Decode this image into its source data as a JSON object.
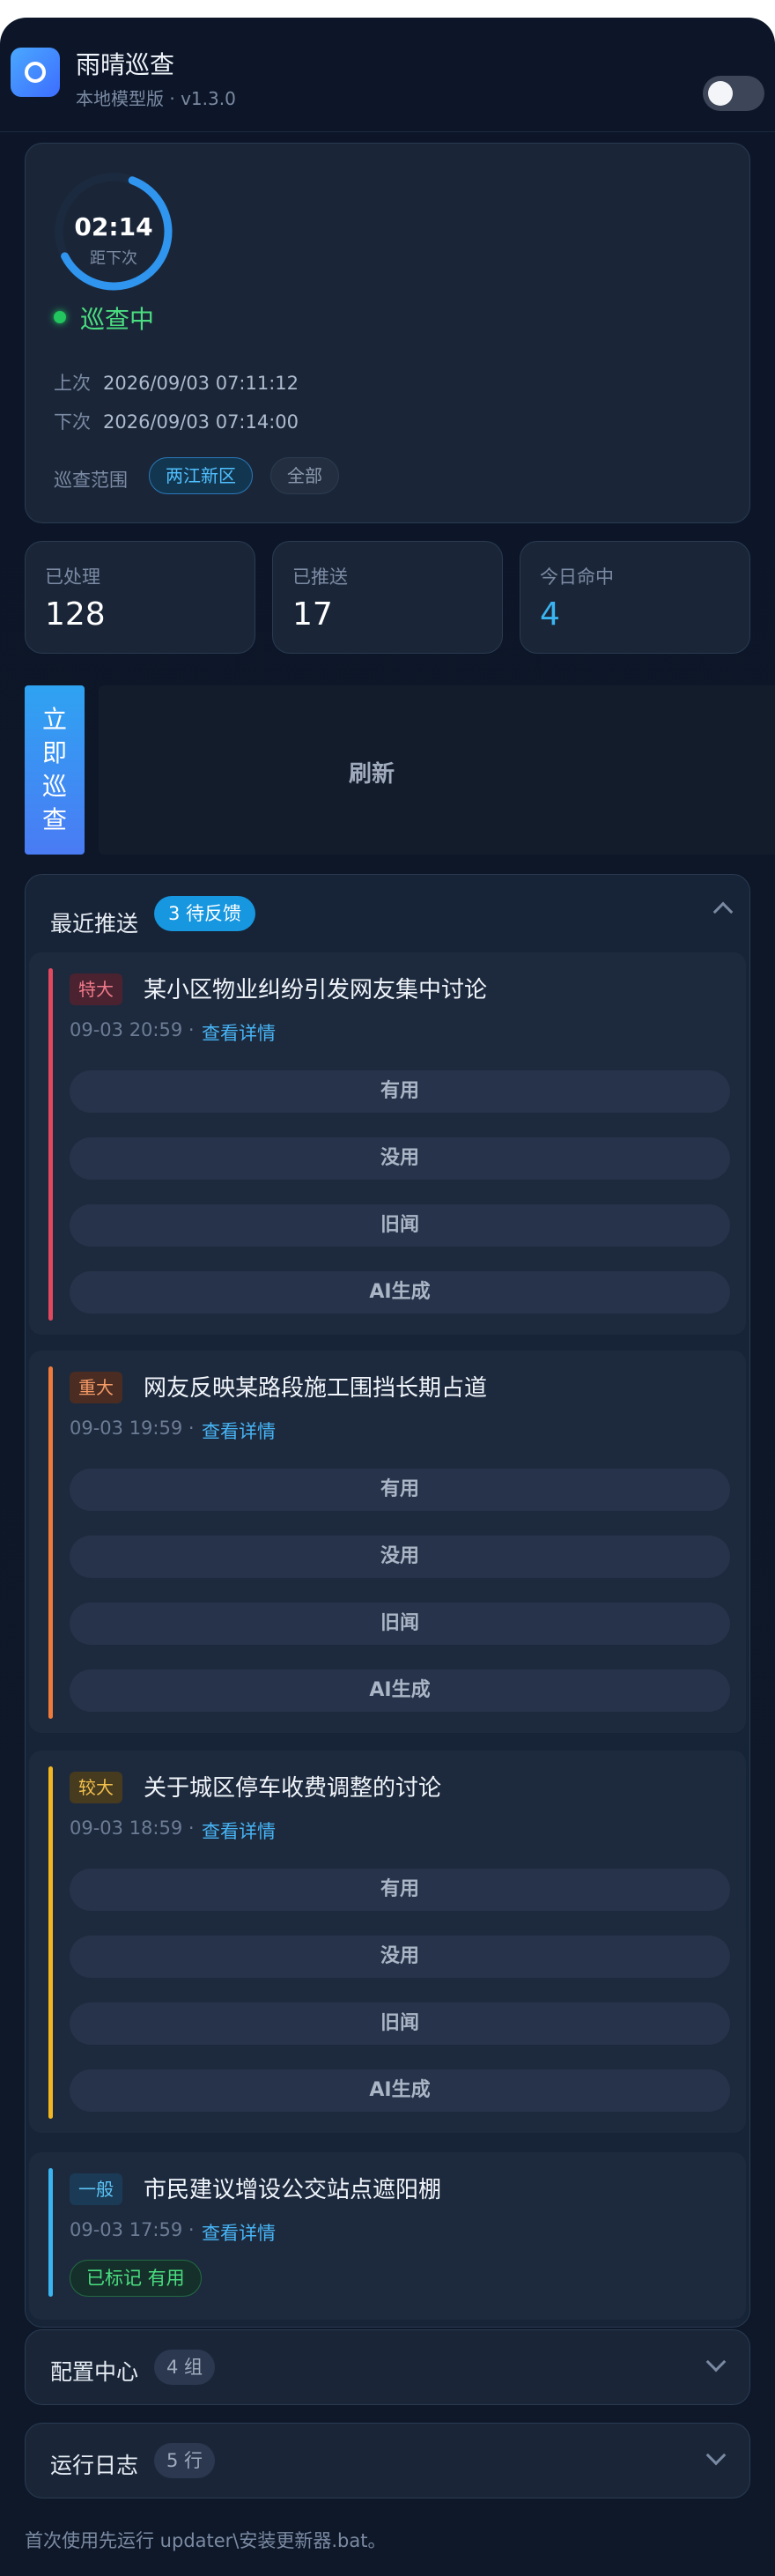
{
  "app": {
    "title": "雨晴巡查",
    "subtitle": "本地模型版 · v1.3.0",
    "toggle_on": false
  },
  "status": {
    "countdown": "02:14",
    "countdown_label": "距下次",
    "progress": 0.62,
    "state": "巡查中",
    "last_label": "上次",
    "last_time": "2026/09/03 07:11:12",
    "next_label": "下次",
    "next_time": "2026/09/03 07:14:00",
    "scope_label": "巡查范围",
    "scope_options": [
      "两江新区",
      "全部"
    ],
    "scope_selected": "两江新区"
  },
  "stats": [
    {
      "label": "已处理",
      "value": "128"
    },
    {
      "label": "已推送",
      "value": "17"
    },
    {
      "label": "今日命中",
      "value": "4"
    }
  ],
  "actions": {
    "patrol": "立\n即\n巡\n查",
    "refresh": "刷新"
  },
  "push": {
    "title": "最近推送",
    "badge": "3 待反馈",
    "detail_link": "查看详情",
    "feedback_options": [
      "有用",
      "没用",
      "旧闻",
      "AI生成"
    ],
    "items": [
      {
        "severity": "特大",
        "severity_color": "#e2485f",
        "title": "某小区物业纠纷引发网友集中讨论",
        "time": "09-03 20:59 ·"
      },
      {
        "severity": "重大",
        "severity_color": "#ef7a3c",
        "title": "网友反映某路段施工围挡长期占道",
        "time": "09-03 19:59 ·"
      },
      {
        "severity": "较大",
        "severity_color": "#f2b620",
        "title": "关于城区停车收费调整的讨论",
        "time": "09-03 18:59 ·"
      },
      {
        "severity": "一般",
        "severity_color": "#3bb4f2",
        "title": "市民建议增设公交站点遮阳棚",
        "time": "09-03 17:59 ·",
        "marked": "已标记 有用"
      }
    ]
  },
  "config": {
    "title": "配置中心",
    "count": "4 组"
  },
  "log": {
    "title": "运行日志",
    "count": "5 行"
  },
  "footer": "首次使用先运行 updater\\安装更新器.bat。",
  "colors": {
    "accent": "#1697e0",
    "success": "#4ade80",
    "background": "#0c1628"
  }
}
